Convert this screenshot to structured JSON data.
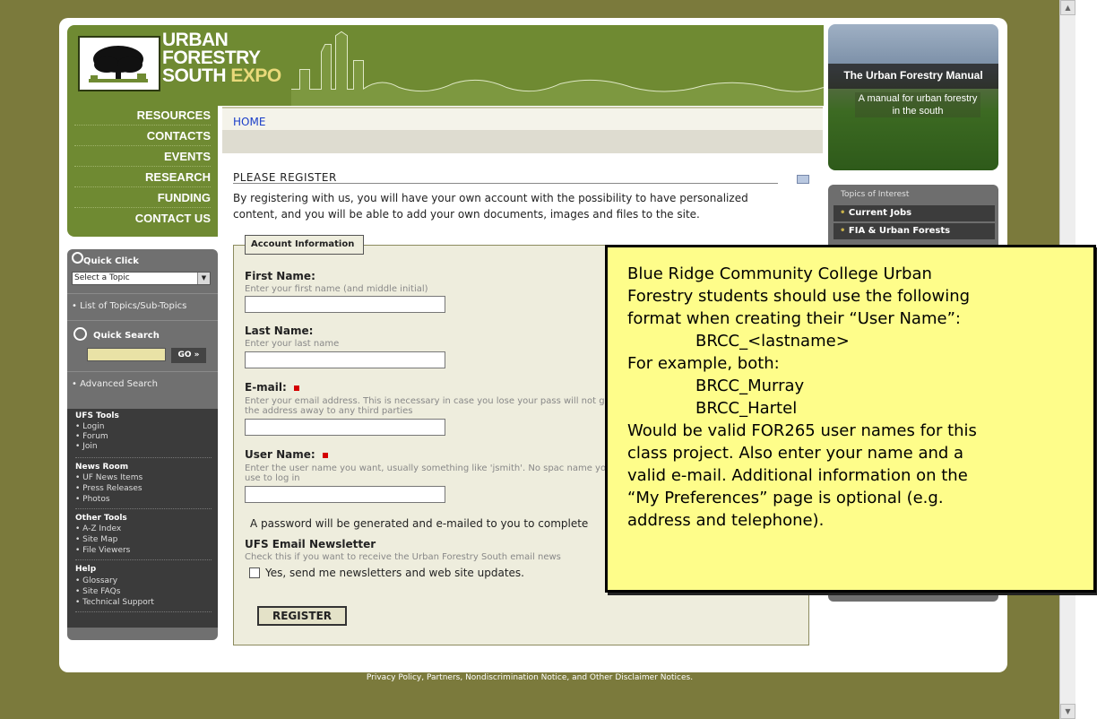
{
  "header": {
    "logo_line1": "URBAN",
    "logo_line2": "FORESTRY",
    "logo_line3": "SOUTH",
    "logo_line3b": "EXPO"
  },
  "banner": {
    "title": "The Urban Forestry Manual",
    "subtitle": "A manual for urban forestry in the south"
  },
  "nav": {
    "items": [
      "RESOURCES",
      "CONTACTS",
      "EVENTS",
      "RESEARCH",
      "FUNDING",
      "CONTACT US"
    ]
  },
  "breadcrumb": {
    "home": "HOME"
  },
  "main": {
    "title": "PLEASE REGISTER",
    "intro": "By registering with us, you will have your own account with the possibility to have personalized content, and you will be able to add your own documents, images and files to the site.",
    "legend": "Account Information",
    "fields": [
      {
        "label": "First Name:",
        "help": "Enter your first name (and middle initial)",
        "required": false
      },
      {
        "label": "Last Name:",
        "help": "Enter your last name",
        "required": false
      },
      {
        "label": "E-mail:",
        "help": "Enter your email address. This is necessary in case you lose your pass will not give the address away to any third parties",
        "required": true
      },
      {
        "label": "User Name:",
        "help": "Enter the user name you want, usually something like 'jsmith'. No spac name you use to log in",
        "required": true
      }
    ],
    "password_note": "A password will be generated and e-mailed to you to complete",
    "newsletter_title": "UFS Email Newsletter",
    "newsletter_help": "Check this if you want to receive the Urban Forestry South email news",
    "newsletter_check": "Yes, send me newsletters and web site updates.",
    "register_button": "REGISTER"
  },
  "sidebar": {
    "quick_click": "Quick Click",
    "select_topic": "Select a Topic",
    "list_topics": "• List of Topics/Sub-Topics",
    "quick_search": "Quick Search",
    "go": "GO »",
    "advanced_search": "• Advanced Search",
    "tools": [
      {
        "head": "UFS Tools",
        "items": [
          "• Login",
          "• Forum",
          "• Join"
        ]
      },
      {
        "head": "News Room",
        "items": [
          "• UF News Items",
          "• Press Releases",
          "• Photos"
        ]
      },
      {
        "head": "Other Tools",
        "items": [
          "• A-Z Index",
          "• Site Map",
          "• File Viewers"
        ]
      },
      {
        "head": "Help",
        "items": [
          "• Glossary",
          "• Site FAQs",
          "• Technical Support"
        ]
      }
    ]
  },
  "topics": {
    "title": "Topics of Interest",
    "items": [
      "Current Jobs",
      "FIA & Urban Forests"
    ]
  },
  "note": {
    "lines": [
      "Blue Ridge Community College Urban",
      "Forestry students should use the following",
      "format when creating their “User Name”:",
      "BRCC_<lastname>",
      "For example, both:",
      "BRCC_Murray",
      "BRCC_Hartel",
      "Would be valid FOR265 user names for this",
      "class project. Also enter your name and a",
      "valid e-mail. Additional information on the",
      "“My Preferences” page is optional (e.g.",
      "address and telephone)."
    ]
  },
  "footer": "Privacy Policy, Partners, Nondiscrimination Notice, and Other Disclaimer Notices.",
  "colors": {
    "background": "#7b7a3c",
    "header_green": "#6f8a32",
    "note_yellow": "#fefd8a",
    "form_bg": "#eeeddd"
  }
}
